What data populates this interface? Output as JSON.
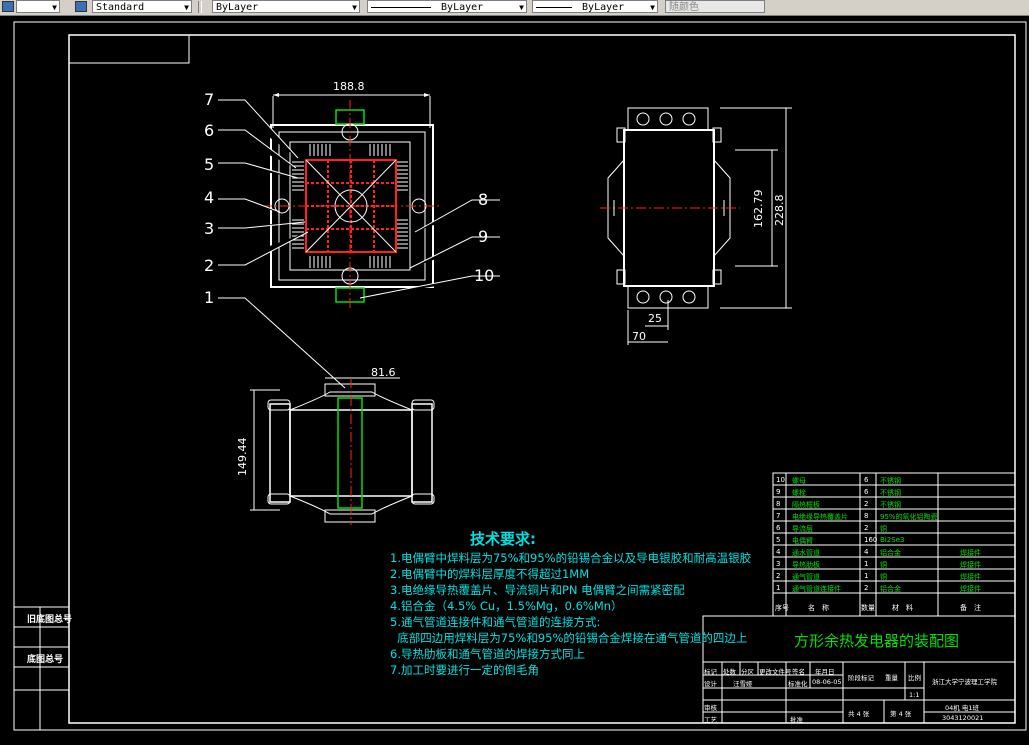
{
  "toolbar": {
    "text_style": "Standard",
    "layer": "ByLayer",
    "linetype": "ByLayer",
    "lineweight": "ByLayer",
    "color": "随颜色"
  },
  "views": {
    "front": {
      "dim_width": "188.8"
    },
    "side": {
      "dim_h1": "162.79",
      "dim_h2": "228.8",
      "dim_w1": "25",
      "dim_w2": "70"
    },
    "bottom": {
      "dim_width": "81.6",
      "dim_height": "149.44"
    }
  },
  "callouts": [
    "7",
    "6",
    "5",
    "4",
    "3",
    "2",
    "1",
    "8",
    "9",
    "10"
  ],
  "tech_requirements": {
    "title": "技术要求:",
    "lines": [
      "1.电偶臂中焊料层为75%和95%的铅锡合金以及导电银胶和耐高温银胶",
      "2.电偶臂中的焊料层厚度不得超过1MM",
      "3.电绝缘导热覆盖片、导流铜片和PN 电偶臂之间需紧密配",
      "4.铝合金（4.5% Cu，1.5%Mg，0.6%Mn）",
      "5.通气管道连接件和通气管道的连接方式:",
      "  底部四边用焊料层为75%和95%的铅锡合金焊接在通气管道的四边上",
      "6.导热肋板和通气管道的焊接方式同上",
      "7.加工时要进行一定的倒毛角"
    ]
  },
  "bom": {
    "rows": [
      {
        "no": "10",
        "name": "螺母",
        "qty": "6",
        "mat": "不锈钢",
        "note": ""
      },
      {
        "no": "9",
        "name": "螺栓",
        "qty": "6",
        "mat": "不锈钢",
        "note": ""
      },
      {
        "no": "8",
        "name": "隔热框板",
        "qty": "2",
        "mat": "不锈钢",
        "note": ""
      },
      {
        "no": "7",
        "name": "电绝缘导热覆盖片",
        "qty": "8",
        "mat": "95%的氧化铝陶瓷",
        "note": ""
      },
      {
        "no": "6",
        "name": "导流层",
        "qty": "2",
        "mat": "铜",
        "note": ""
      },
      {
        "no": "5",
        "name": "电偶臂",
        "qty": "160",
        "mat": "Bi2Se3",
        "note": ""
      },
      {
        "no": "4",
        "name": "通水管道",
        "qty": "4",
        "mat": "铝合金",
        "note": "焊接件"
      },
      {
        "no": "3",
        "name": "导热肋板",
        "qty": "1",
        "mat": "铜",
        "note": "焊接件"
      },
      {
        "no": "2",
        "name": "通气管道",
        "qty": "1",
        "mat": "铜",
        "note": "焊接件"
      },
      {
        "no": "1",
        "name": "通气管道连接件",
        "qty": "2",
        "mat": "铝合金",
        "note": "焊接件"
      }
    ],
    "headers": {
      "no": "序号",
      "name": "名　称",
      "qty": "数量",
      "mat": "材　料",
      "note": "备　注"
    }
  },
  "title_block": {
    "title": "方形余热发电器的装配图",
    "school": "浙江大学宁波理工学院",
    "class": "04机 电1班",
    "student_no": "3043120021",
    "scale": "1:1",
    "designer": "汪雪娅",
    "sheet_total": "共 4 张",
    "sheet_no": "第 4 张",
    "date": "08-06-05",
    "labels": {
      "mark": "标记",
      "count": "处数",
      "zone": "分区",
      "doc": "更改文件号",
      "sign": "签名",
      "ymd": "年月日",
      "design": "设计",
      "standard": "标准化",
      "stage": "阶段标记",
      "weight": "重量",
      "ratio": "比例",
      "review": "审核",
      "process": "工艺",
      "approve": "批准"
    }
  },
  "side_labels": {
    "label1": "旧底图总号",
    "label2": "底图总号"
  }
}
